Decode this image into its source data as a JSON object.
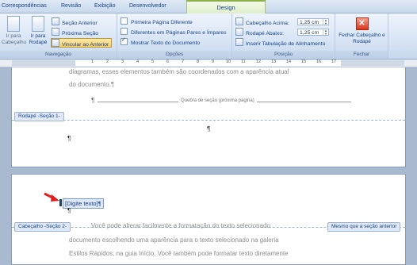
{
  "tabs": [
    "Correspondências",
    "Revisão",
    "Exibição",
    "Desenvolvedor"
  ],
  "active_tab": "Design",
  "ribbon": {
    "navigation": {
      "label": "Navegação",
      "go_header": "Ir para Cabeçalho",
      "go_footer": "Ir para Rodapé",
      "prev_section": "Seção Anterior",
      "next_section": "Próxima Seção",
      "link_previous": "Vincular ao Anterior"
    },
    "options": {
      "label": "Opções",
      "different_first_page": "Primeira Página Diferente",
      "different_odd_even": "Diferentes em Páginas Pares e Ímpares",
      "show_document_text": "Mostrar Texto do Documento"
    },
    "position": {
      "label": "Posição",
      "header_top_label": "Cabeçalho Acima:",
      "header_top_value": "1,25 cm",
      "footer_bottom_label": "Rodapé Abaixo:",
      "footer_bottom_value": "1,25 cm",
      "insert_alignment_tab": "Inserir Tabulação de Alinhamento"
    },
    "close": {
      "label": "Fechar",
      "close_button": "Fechar Cabeçalho e Rodapé"
    }
  },
  "ruler": {
    "numbers": [
      "1",
      "2",
      "3",
      "4",
      "5",
      "6",
      "7",
      "8",
      "9",
      "10",
      "11",
      "12",
      "13",
      "14",
      "15",
      "16",
      "17"
    ]
  },
  "page1": {
    "line1": "diagramas, esses elementos também são coordenados com a aparência atual",
    "line2": "do documento.¶",
    "section_break": "Quebra de seção (próxima página)",
    "footer_tag": "Rodapé -Seção 1-",
    "pilcrow": "¶"
  },
  "page2": {
    "placeholder": "[Digite texto]",
    "pilcrow": "¶",
    "header_tag": "Cabeçalho -Seção 2-",
    "same_as_previous": "Mesmo que a seção anterior",
    "body1": "Você pode alterar facilmente a formatação do texto selecionado",
    "body2": "documento escolhendo uma aparência para o texto selecionado na galeria",
    "body3": "Estilos Rápidos, na guia Início. Você também pode formatar texto diretamente"
  },
  "colors": {
    "accent": "#15428b",
    "ribbon_bg": "#d4e2f3",
    "workspace": "#a9b9cf",
    "annotation_arrow": "#e02020"
  }
}
